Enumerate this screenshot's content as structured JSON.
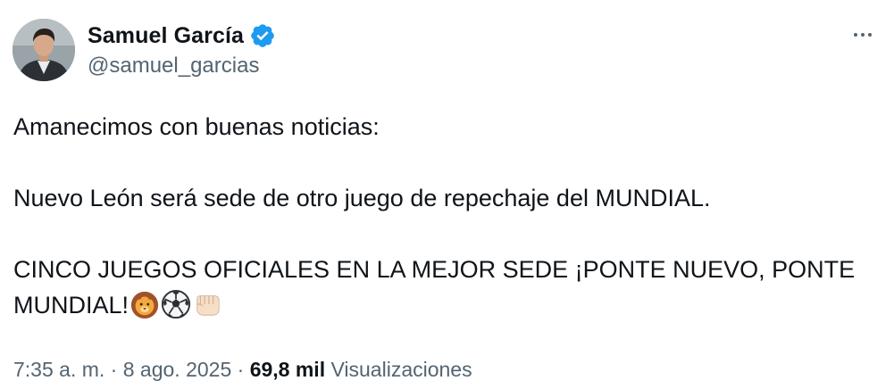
{
  "author": {
    "display_name": "Samuel García",
    "handle": "@samuel_garcias",
    "verified_color": "#1d9bf0"
  },
  "menu": {
    "icon": "more-horizontal-icon"
  },
  "tweet": {
    "line1": "Amanecimos con buenas noticias:",
    "line2": "Nuevo León será sede de otro juego de repechaje del MUNDIAL.",
    "line3": "CINCO JUEGOS OFICIALES EN LA MEJOR SEDE ¡PONTE NUEVO, PONTE MUNDIAL!",
    "emojis": [
      "lion-face-emoji",
      "soccer-ball-emoji",
      "oncoming-fist-emoji"
    ]
  },
  "meta": {
    "time": "7:35 a. m.",
    "separator1": "·",
    "date": "8 ago. 2025",
    "separator2": "·",
    "views_count": "69,8 mil",
    "views_label": "Visualizaciones"
  }
}
